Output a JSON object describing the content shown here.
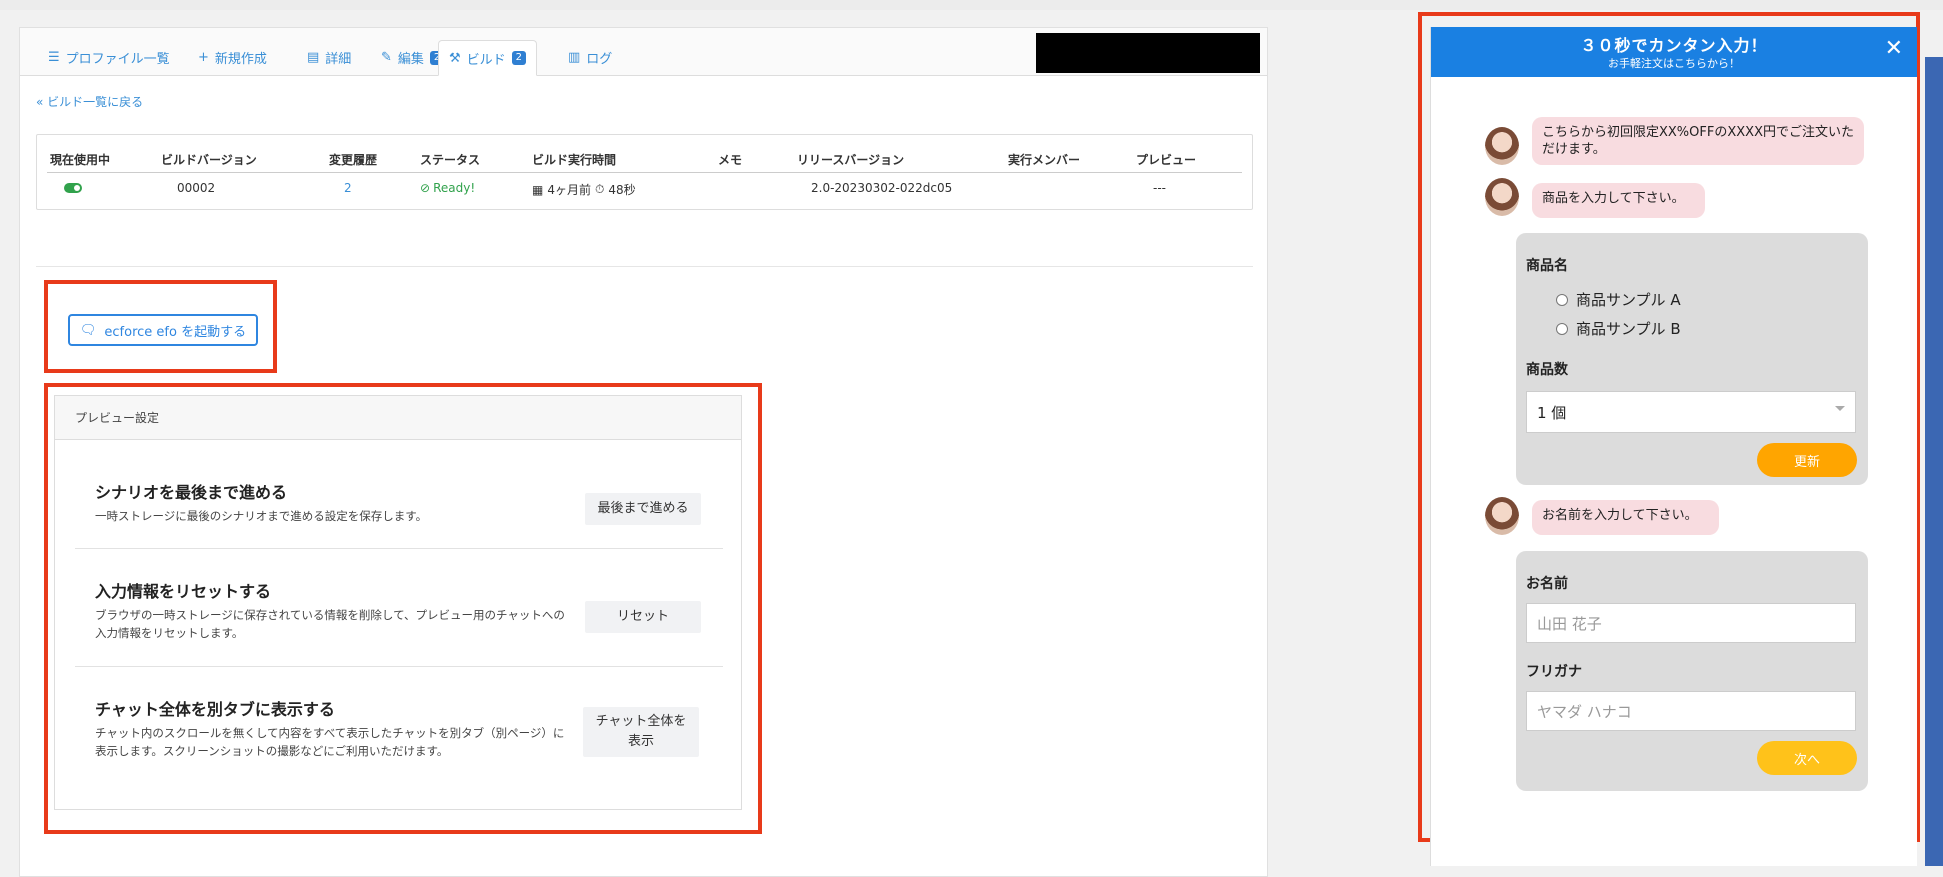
{
  "tabs": [
    {
      "label": "プロファイル一覧",
      "icon": "list-icon"
    },
    {
      "label": "新規作成",
      "icon": "plus-icon"
    },
    {
      "label": "詳細",
      "icon": "file-icon"
    },
    {
      "label": "編集",
      "icon": "edit-icon",
      "badge": "2"
    },
    {
      "label": "ビルド",
      "icon": "wrench-icon",
      "badge": "2",
      "active": true
    },
    {
      "label": "ログ",
      "icon": "chart-icon"
    }
  ],
  "back_link": "« ビルド一覧に戻る",
  "table": {
    "headers": [
      "現在使用中",
      "ビルドバージョン",
      "変更履歴",
      "ステータス",
      "ビルド実行時間",
      "メモ",
      "リリースバージョン",
      "実行メンバー",
      "プレビュー"
    ],
    "row": {
      "version": "00002",
      "history": "2",
      "status": "Ready!",
      "time_ago": "4ヶ月前",
      "duration": "48秒",
      "memo": "",
      "release": "2.0-20230302-022dc05",
      "member": "",
      "preview": "---"
    }
  },
  "efo_button": "ecforce efo を起動する",
  "preview": {
    "header": "プレビュー設定",
    "options": [
      {
        "title": "シナリオを最後まで進める",
        "desc": "一時ストレージに最後のシナリオまで進める設定を保存します。",
        "button": "最後まで進める"
      },
      {
        "title": "入力情報をリセットする",
        "desc": "ブラウザの一時ストレージに保存されている情報を削除して、プレビュー用のチャットへの入力情報をリセットします。",
        "button": "リセット"
      },
      {
        "title": "チャット全体を別タブに表示する",
        "desc": "チャット内のスクロールを無くして内容をすべて表示したチャットを別タブ（別ページ）に表示します。スクリーンショットの撮影などにご利用いただけます。",
        "button": "チャット全体を表示"
      }
    ]
  },
  "chat": {
    "title": "３０秒でカンタン入力！",
    "subtitle": "お手軽注文はこちらから！",
    "close": "✕",
    "msg1": "こちらから初回限定XX%OFFのXXXX円でご注文いただけます。",
    "msg2": "商品を入力して下さい。",
    "product_label": "商品名",
    "product_options": [
      "商品サンプル A",
      "商品サンプル B"
    ],
    "qty_label": "商品数",
    "qty_value": "1 個",
    "update_button": "更新",
    "msg3": "お名前を入力して下さい。",
    "name_label": "お名前",
    "name_placeholder": "山田 花子",
    "kana_label": "フリガナ",
    "kana_placeholder": "ヤマダ ハナコ",
    "next_button": "次へ"
  },
  "colors": {
    "accent": "#2f86e0",
    "header_blue": "#1a80e2",
    "highlight_red": "#e83a1a",
    "orange": "#ffa500",
    "yellow": "#ffc21a",
    "bubble_pink": "#f8dce0"
  }
}
